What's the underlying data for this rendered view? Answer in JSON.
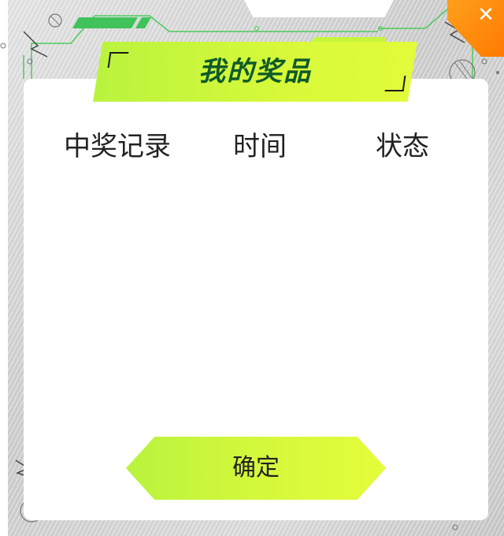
{
  "dialog": {
    "title": "我的奖品",
    "close_label": "✕"
  },
  "table": {
    "headers": [
      "中奖记录",
      "时间",
      "状态"
    ],
    "rows": []
  },
  "confirm_button": {
    "label": "确定"
  },
  "colors": {
    "accent_green": "#c8f53c",
    "title_text": "#0f5a2a",
    "close_orange": "#ff8c00"
  }
}
